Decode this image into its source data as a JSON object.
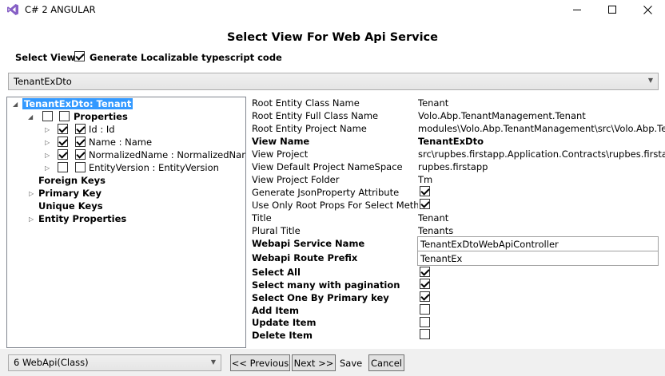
{
  "window": {
    "title": "C# 2 ANGULAR",
    "minimize_glyph": "—",
    "maximize_glyph": "☐",
    "close_glyph": "✕"
  },
  "heading": "Select View For Web Api Service",
  "select_view_label": "Select View.",
  "generate_localizable_label": "Generate Localizable typescript code",
  "generate_localizable_checked": true,
  "dto_select": {
    "value": "TenantExDto"
  },
  "tree": {
    "root": "TenantExDto: Tenant",
    "properties": "Properties",
    "items": [
      {
        "label": "Id : Id",
        "checked": true
      },
      {
        "label": "Name : Name",
        "checked": true
      },
      {
        "label": "NormalizedName : NormalizedName",
        "checked": true
      },
      {
        "label": "EntityVersion : EntityVersion",
        "checked": false
      }
    ],
    "foreign_keys": "Foreign Keys",
    "primary_key": "Primary Key",
    "unique_keys": "Unique Keys",
    "entity_properties": "Entity Properties"
  },
  "props": {
    "root_entity_class_name": {
      "label": "Root Entity Class Name",
      "value": "Tenant"
    },
    "root_entity_full_class_name": {
      "label": "Root Entity Full Class Name",
      "value": "Volo.Abp.TenantManagement.Tenant"
    },
    "root_entity_project_name": {
      "label": "Root Entity Project Name",
      "value": "modules\\Volo.Abp.TenantManagement\\src\\Volo.Abp.Tenan"
    },
    "view_name": {
      "label": "View Name",
      "value": "TenantExDto"
    },
    "view_project": {
      "label": "View Project",
      "value": "src\\rupbes.firstapp.Application.Contracts\\rupbes.firstapp.A"
    },
    "view_default_namespace": {
      "label": "View Default Project NameSpace",
      "value": "rupbes.firstapp"
    },
    "view_project_folder": {
      "label": "View Project Folder",
      "value": "Tm"
    },
    "generate_json_property": {
      "label": "Generate JsonProperty Attribute",
      "checked": true
    },
    "use_only_root_props": {
      "label": "Use Only Root Props For Select Metho",
      "checked": true
    },
    "title": {
      "label": "Title",
      "value": "Tenant"
    },
    "plural_title": {
      "label": "Plural Title",
      "value": "Tenants"
    },
    "webapi_service_name": {
      "label": "Webapi Service Name",
      "value": "TenantExDtoWebApiController"
    },
    "webapi_route_prefix": {
      "label": "Webapi Route Prefix",
      "value": "TenantEx"
    },
    "select_all": {
      "label": "Select All",
      "checked": true
    },
    "select_many": {
      "label": "Select many with pagination",
      "checked": true
    },
    "select_one": {
      "label": "Select One By Primary key",
      "checked": true
    },
    "add_item": {
      "label": "Add Item",
      "checked": false
    },
    "update_item": {
      "label": "Update Item",
      "checked": false
    },
    "delete_item": {
      "label": "Delete Item",
      "checked": false
    }
  },
  "footer": {
    "generator_select": "6 WebApi(Class)",
    "previous": "<< Previous",
    "next": "Next >>",
    "save": "Save",
    "cancel": "Cancel"
  },
  "colors": {
    "selection": "#3399ff",
    "vs_purple": "#865fc5"
  }
}
